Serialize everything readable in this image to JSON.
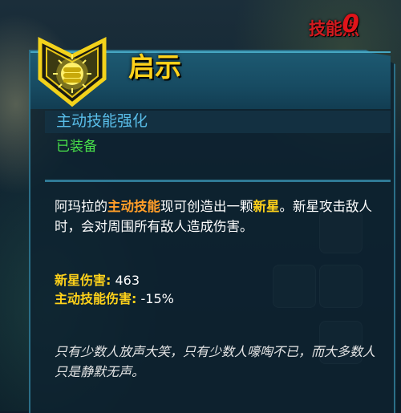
{
  "hud": {
    "skill_points_label": "技能点",
    "skill_points_value": "0"
  },
  "skill": {
    "icon": "fist-icon",
    "name": "启示",
    "type": "主动技能强化",
    "status": "已装备",
    "description": {
      "part1": "阿玛拉的",
      "highlight1": "主动技能",
      "part2": "现可创造出一颗",
      "highlight2": "新星",
      "part3": "。新星攻击敌人时，会对周围所有敌人造成伤害。"
    },
    "stats": [
      {
        "label": "新星伤害:",
        "value": "463"
      },
      {
        "label": "主动技能伤害:",
        "value": "-15%"
      }
    ],
    "flavor_text": "只有少数人放声大笑，只有少数人嚎啕不已，而大多数人只是静默无声。"
  },
  "colors": {
    "title": "#ffd21a",
    "skill_type": "#59bde8",
    "equipped": "#49e34a",
    "highlight": "#ff9d28",
    "skill_points": "#e0141a",
    "panel_border": "#2b6f88"
  }
}
